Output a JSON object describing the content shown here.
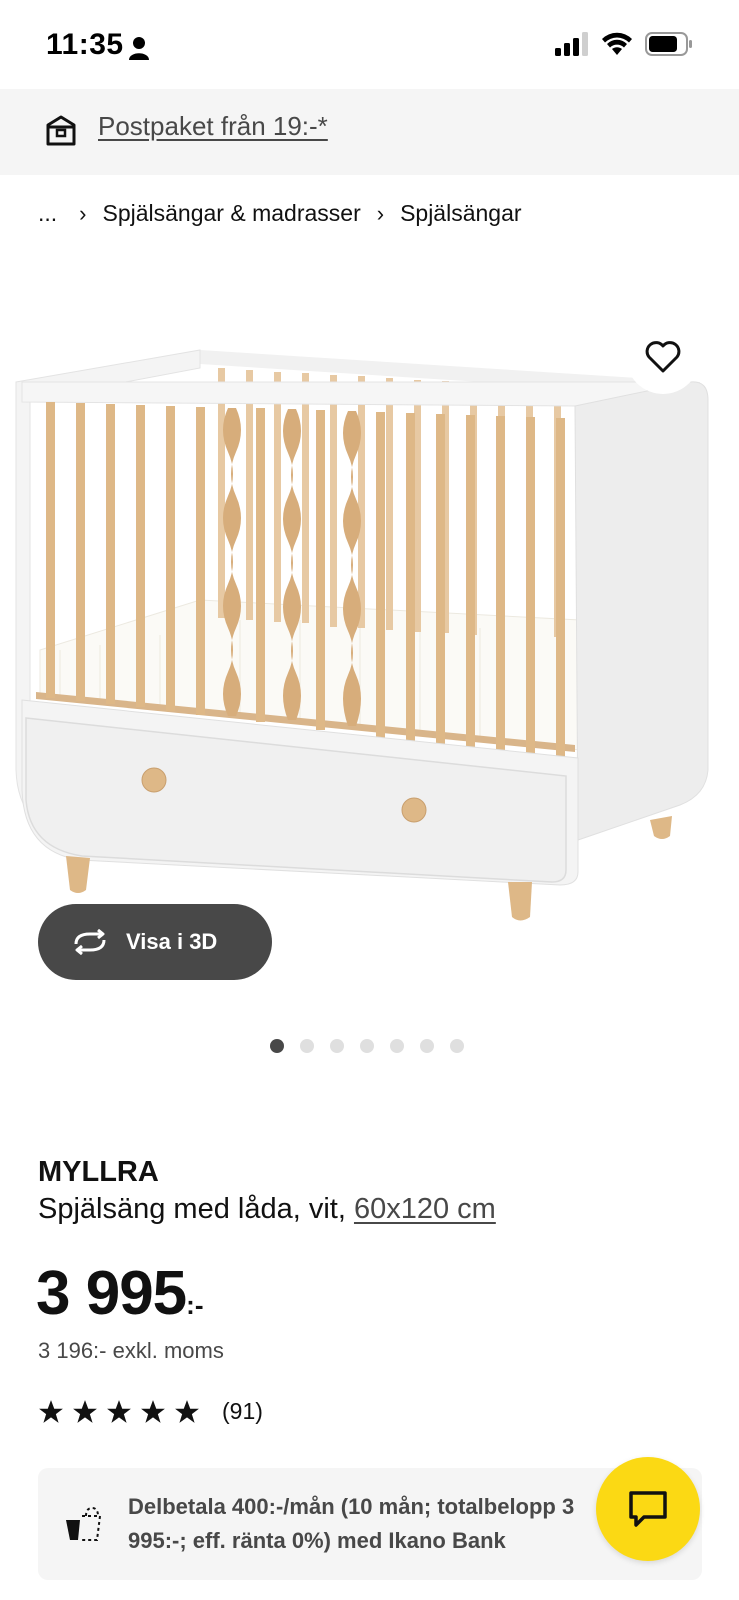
{
  "status_bar": {
    "time": "11:35",
    "icons": [
      "person-icon",
      "signal-icon",
      "wifi-icon",
      "battery-icon"
    ]
  },
  "promo": {
    "icon": "parcel-icon",
    "text": "Postpaket från 19:-*"
  },
  "breadcrumb": {
    "items": [
      "...",
      "Spjälsängar & madrasser",
      "Spjälsängar"
    ],
    "separator_icon": "chevron-right-icon"
  },
  "gallery": {
    "favorite_icon": "heart-icon",
    "view_3d_label": "Visa i 3D",
    "view_3d_icon": "rotate-3d-icon",
    "dots_total": 7,
    "active_dot": 1
  },
  "product": {
    "name": "MYLLRA",
    "description": "Spjälsäng med låda, vit,",
    "size_link": "60x120 cm",
    "price": "3 995",
    "price_suffix": ":-",
    "price_excl_vat": "3 196:- exkl. moms",
    "rating_stars": 4.5,
    "review_count": "(91)"
  },
  "financing": {
    "icon": "payment-icon",
    "text": "Delbetala 400:-/mån (10 mån; totalbelopp 3 995:-; eff. ränta 0%) med Ikano Bank"
  },
  "chat": {
    "icon": "chat-icon"
  },
  "colors": {
    "accent_yellow": "#fbd914",
    "dark_gray": "#484848",
    "light_gray": "#f5f5f5",
    "text": "#111111",
    "wood": "#deb887"
  }
}
